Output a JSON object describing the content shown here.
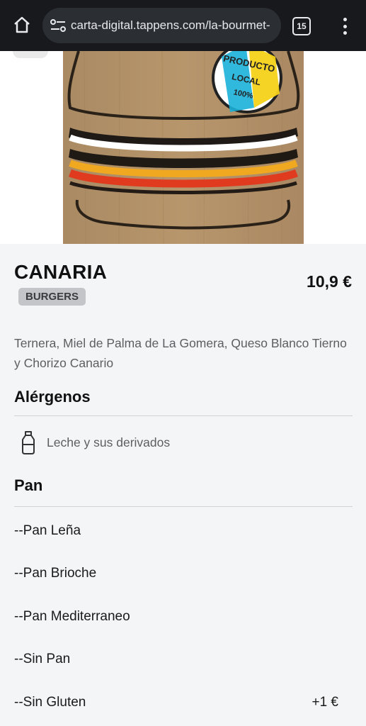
{
  "browser": {
    "url": "carta-digital.tappens.com/la-bourmet-",
    "tab_count": "15",
    "icons": [
      "home-icon",
      "site-settings-icon",
      "tab-switcher-icon",
      "more-vert-icon"
    ]
  },
  "hero_image": {
    "badge_lines": [
      "PRODUCTO",
      "LOCAL",
      "100%"
    ]
  },
  "product": {
    "name": "CANARIA",
    "price": "10,9 €",
    "category": "BURGERS",
    "description": "Ternera, Miel de Palma de La Gomera, Queso Blanco Tierno y Chorizo Canario"
  },
  "allergens": {
    "title": "Alérgenos",
    "items": [
      {
        "label": "Leche y sus derivados",
        "icon": "milk-bottle-icon"
      }
    ]
  },
  "bread": {
    "title": "Pan",
    "options": [
      {
        "label": "--Pan Leña",
        "price": ""
      },
      {
        "label": "--Pan Brioche",
        "price": ""
      },
      {
        "label": "--Pan Mediterraneo",
        "price": ""
      },
      {
        "label": "--Sin Pan",
        "price": ""
      },
      {
        "label": "--Sin Gluten",
        "price": "+1 €"
      }
    ]
  },
  "colors": {
    "browser_bar": "#17191c",
    "page_bg": "#f4f5f7",
    "badge_bg": "#c4c5c8",
    "wood": "#b39169"
  }
}
